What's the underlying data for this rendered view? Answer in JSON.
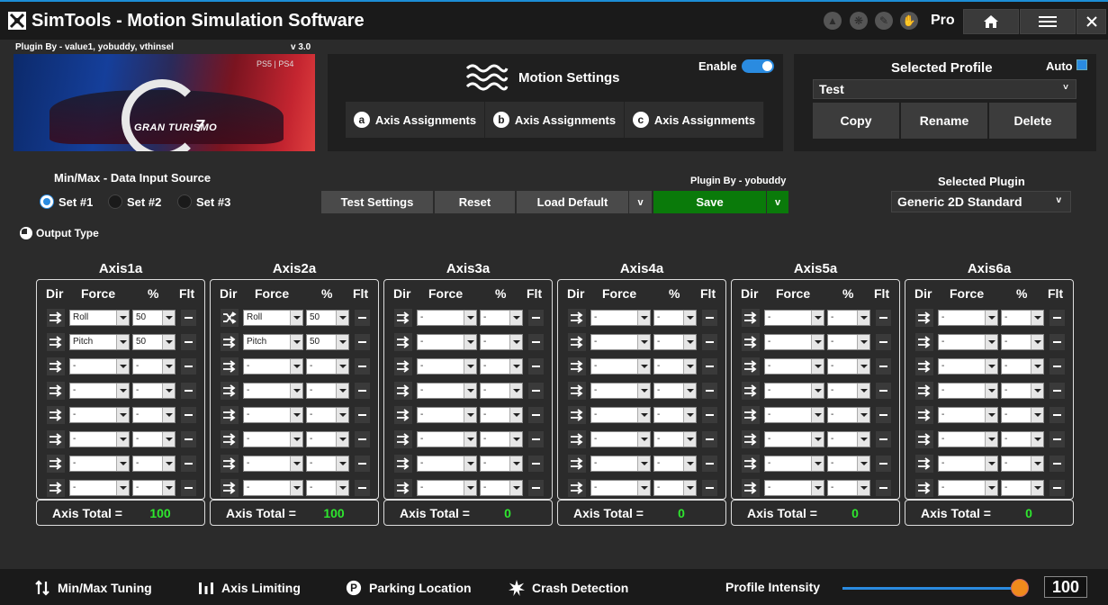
{
  "app": {
    "title": "SimTools - Motion Simulation Software",
    "tier": "Pro"
  },
  "titlebar_icons": [
    "upload-icon",
    "gear-icon",
    "wrench-icon",
    "power-icon"
  ],
  "plugin_banner": {
    "plugin_by": "Plugin By - value1, yobuddy, vthinsel",
    "version": "v 3.0",
    "game_title": "GRAN TURISMO",
    "game_number": "7",
    "platform": "PS5 | PS4"
  },
  "motion_settings": {
    "title": "Motion Settings",
    "enable_label": "Enable",
    "enabled": true,
    "tabs": [
      {
        "badge": "a",
        "label": "Axis Assignments"
      },
      {
        "badge": "b",
        "label": "Axis Assignments"
      },
      {
        "badge": "c",
        "label": "Axis Assignments"
      }
    ]
  },
  "profile": {
    "title": "Selected Profile",
    "auto_label": "Auto",
    "auto_checked": true,
    "selected": "Test",
    "buttons": [
      "Copy",
      "Rename",
      "Delete"
    ]
  },
  "minmax": {
    "title": "Min/Max - Data Input Source",
    "sets": [
      "Set #1",
      "Set #2",
      "Set #3"
    ],
    "selected_index": 0
  },
  "output_type_label": "Output Type",
  "actions": {
    "test": "Test Settings",
    "reset": "Reset",
    "load_default": "Load Default",
    "load_chevron": "v",
    "plugin_by": "Plugin By - yobuddy",
    "save": "Save",
    "save_chevron": "v"
  },
  "selected_plugin": {
    "title": "Selected Plugin",
    "value": "Generic 2D Standard",
    "chevron": "v"
  },
  "column_headers": {
    "dir": "Dir",
    "force": "Force",
    "pct": "%",
    "flt": "Flt"
  },
  "total_label": "Axis Total =",
  "axes": [
    {
      "name": "Axis1a",
      "total": "100",
      "rows": [
        {
          "force": "Roll",
          "pct": "50",
          "dir": "arrow"
        },
        {
          "force": "Pitch",
          "pct": "50",
          "dir": "arrow"
        },
        {
          "force": "-",
          "pct": "-",
          "dir": "arrow"
        },
        {
          "force": "-",
          "pct": "-",
          "dir": "arrow"
        },
        {
          "force": "-",
          "pct": "-",
          "dir": "arrow"
        },
        {
          "force": "-",
          "pct": "-",
          "dir": "arrow"
        },
        {
          "force": "-",
          "pct": "-",
          "dir": "arrow"
        },
        {
          "force": "-",
          "pct": "-",
          "dir": "arrow"
        }
      ]
    },
    {
      "name": "Axis2a",
      "total": "100",
      "rows": [
        {
          "force": "Roll",
          "pct": "50",
          "dir": "cross"
        },
        {
          "force": "Pitch",
          "pct": "50",
          "dir": "arrow"
        },
        {
          "force": "-",
          "pct": "-",
          "dir": "arrow"
        },
        {
          "force": "-",
          "pct": "-",
          "dir": "arrow"
        },
        {
          "force": "-",
          "pct": "-",
          "dir": "arrow"
        },
        {
          "force": "-",
          "pct": "-",
          "dir": "arrow"
        },
        {
          "force": "-",
          "pct": "-",
          "dir": "arrow"
        },
        {
          "force": "-",
          "pct": "-",
          "dir": "arrow"
        }
      ]
    },
    {
      "name": "Axis3a",
      "total": "0",
      "rows": [
        {
          "force": "-",
          "pct": "-",
          "dir": "arrow"
        },
        {
          "force": "-",
          "pct": "-",
          "dir": "arrow"
        },
        {
          "force": "-",
          "pct": "-",
          "dir": "arrow"
        },
        {
          "force": "-",
          "pct": "-",
          "dir": "arrow"
        },
        {
          "force": "-",
          "pct": "-",
          "dir": "arrow"
        },
        {
          "force": "-",
          "pct": "-",
          "dir": "arrow"
        },
        {
          "force": "-",
          "pct": "-",
          "dir": "arrow"
        },
        {
          "force": "-",
          "pct": "-",
          "dir": "arrow"
        }
      ]
    },
    {
      "name": "Axis4a",
      "total": "0",
      "rows": [
        {
          "force": "-",
          "pct": "-",
          "dir": "arrow"
        },
        {
          "force": "-",
          "pct": "-",
          "dir": "arrow"
        },
        {
          "force": "-",
          "pct": "-",
          "dir": "arrow"
        },
        {
          "force": "-",
          "pct": "-",
          "dir": "arrow"
        },
        {
          "force": "-",
          "pct": "-",
          "dir": "arrow"
        },
        {
          "force": "-",
          "pct": "-",
          "dir": "arrow"
        },
        {
          "force": "-",
          "pct": "-",
          "dir": "arrow"
        },
        {
          "force": "-",
          "pct": "-",
          "dir": "arrow"
        }
      ]
    },
    {
      "name": "Axis5a",
      "total": "0",
      "rows": [
        {
          "force": "-",
          "pct": "-",
          "dir": "arrow"
        },
        {
          "force": "-",
          "pct": "-",
          "dir": "arrow"
        },
        {
          "force": "-",
          "pct": "-",
          "dir": "arrow"
        },
        {
          "force": "-",
          "pct": "-",
          "dir": "arrow"
        },
        {
          "force": "-",
          "pct": "-",
          "dir": "arrow"
        },
        {
          "force": "-",
          "pct": "-",
          "dir": "arrow"
        },
        {
          "force": "-",
          "pct": "-",
          "dir": "arrow"
        },
        {
          "force": "-",
          "pct": "-",
          "dir": "arrow"
        }
      ]
    },
    {
      "name": "Axis6a",
      "total": "0",
      "rows": [
        {
          "force": "-",
          "pct": "-",
          "dir": "arrow"
        },
        {
          "force": "-",
          "pct": "-",
          "dir": "arrow"
        },
        {
          "force": "-",
          "pct": "-",
          "dir": "arrow"
        },
        {
          "force": "-",
          "pct": "-",
          "dir": "arrow"
        },
        {
          "force": "-",
          "pct": "-",
          "dir": "arrow"
        },
        {
          "force": "-",
          "pct": "-",
          "dir": "arrow"
        },
        {
          "force": "-",
          "pct": "-",
          "dir": "arrow"
        },
        {
          "force": "-",
          "pct": "-",
          "dir": "arrow"
        }
      ]
    }
  ],
  "bottom_nav": [
    {
      "label": "Min/Max Tuning",
      "icon": "updown-arrows-icon"
    },
    {
      "label": "Axis Limiting",
      "icon": "bars-icon"
    },
    {
      "label": "Parking Location",
      "icon": "parking-icon"
    },
    {
      "label": "Crash Detection",
      "icon": "crash-icon"
    }
  ],
  "intensity": {
    "label": "Profile Intensity",
    "value": "100",
    "level_fraction": 1.0
  },
  "colors": {
    "accent": "#2a8be0",
    "save_green": "#0a7a0a",
    "total_green": "#2ee62e",
    "slider_knob": "#f08a1c"
  }
}
